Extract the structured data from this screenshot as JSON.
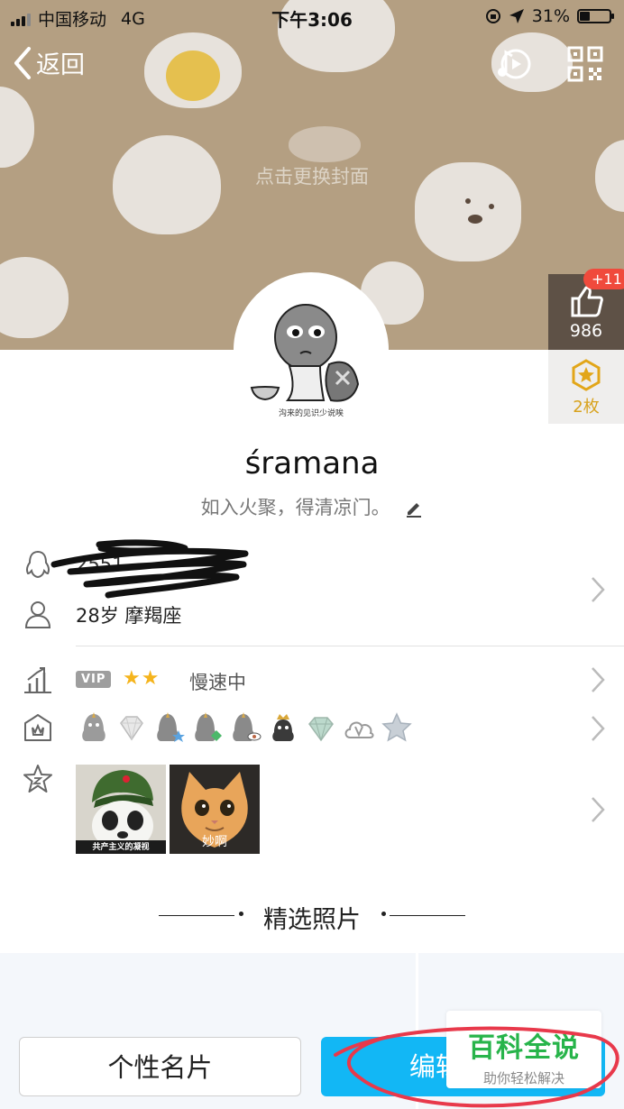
{
  "status_bar": {
    "carrier": "中国移动",
    "network": "4G",
    "time": "下午3:06",
    "battery": "31%",
    "battery_level": 0.31
  },
  "nav": {
    "back_label": "返回",
    "icons": [
      "back-chevron-icon",
      "music-note-icon",
      "qr-code-icon"
    ]
  },
  "cover": {
    "hint": "点击更换封面"
  },
  "side_panel": {
    "likes_badge": "+11",
    "likes_count": "986",
    "medals_label": "2枚"
  },
  "profile": {
    "avatar_caption": "沟来的见识少说唉",
    "name": "śramana",
    "signature": "如入火聚，得清凉门。"
  },
  "info": {
    "qq_number_visible": "2551",
    "age_constellation": "28岁 摩羯座"
  },
  "level": {
    "vip_label": "VIP",
    "stars": "★★",
    "status": "慢速中"
  },
  "badge_icons": [
    "penguin-badge-icon",
    "diamond-badge-icon",
    "penguin-star-icon",
    "penguin-green-icon",
    "penguin-eye-icon",
    "penguin-crown-icon",
    "diamond-green-icon",
    "cloud-v-icon",
    "star-badge-icon"
  ],
  "emoji_photos": [
    {
      "caption": "共产主义的凝视"
    },
    {
      "caption": "妙啊"
    }
  ],
  "selected_photos": {
    "title": "精选照片"
  },
  "buttons": {
    "profile_card": "个性名片",
    "edit_profile": "编辑"
  },
  "watermark": {
    "title": "百科全说",
    "subtitle": "助你轻松解决"
  },
  "colors": {
    "cover": "#b49f82",
    "accent": "#12b7f5",
    "like_badge": "#f04a3c",
    "medal": "#d8a21d",
    "watermark_green": "#27b44a"
  }
}
